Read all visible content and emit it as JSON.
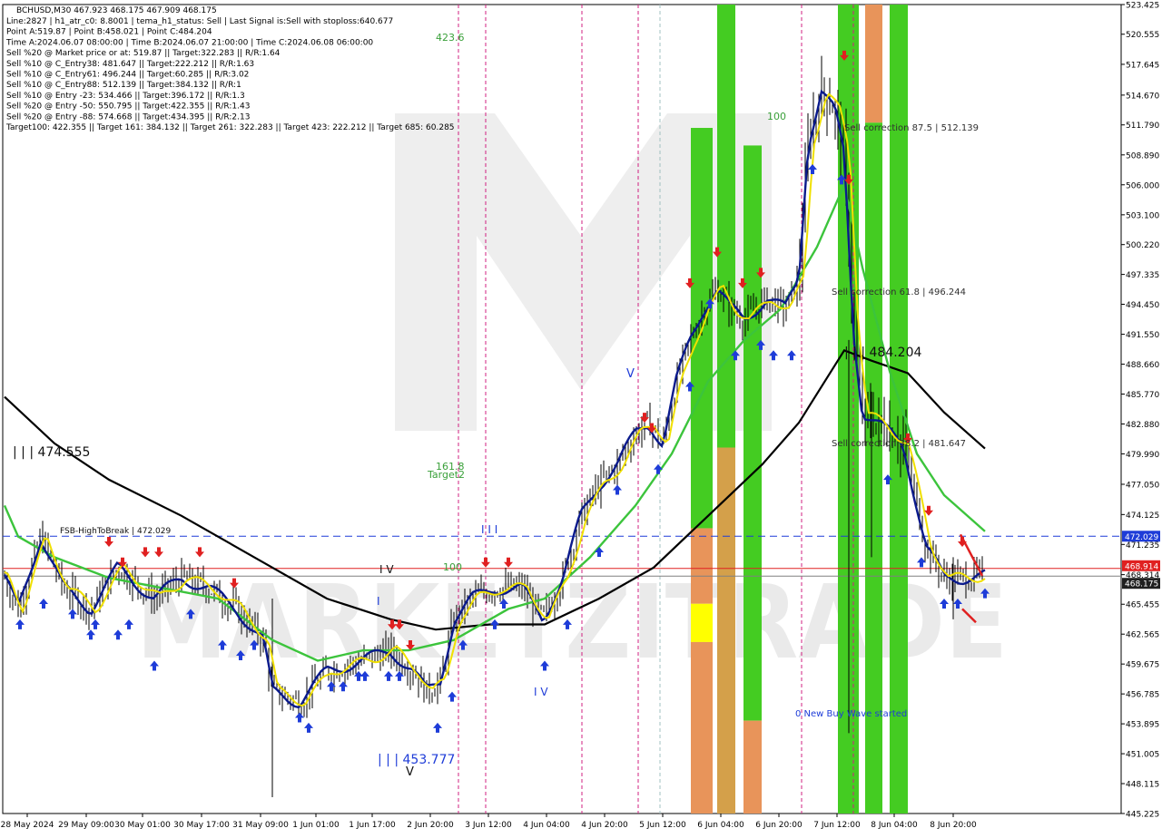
{
  "chart_data": {
    "type": "candlestick",
    "symbol_line": "BCHUSD,M30  467.923 468.175 467.909 468.175",
    "info_lines": [
      "Line:2827  |  h1_atr_c0: 8.8001  |  tema_h1_status: Sell  |  Last Signal is:Sell with stoploss:640.677",
      "Point A:519.87  |  Point B:458.021  |  Point C:484.204",
      "Time A:2024.06.07 08:00:00  |  Time B:2024.06.07 21:00:00  |  Time C:2024.06.08 06:00:00",
      "Sell %20 @ Market price or at: 519.87  ||  Target:322.283  ||  R/R:1.64",
      "Sell %10 @ C_Entry38: 481.647  ||  Target:222.212  ||  R/R:1.63",
      "Sell %10 @ C_Entry61: 496.244  ||  Target:60.285  ||  R/R:3.02",
      "Sell %10 @ C_Entry88: 512.139  ||  Target:384.132  ||  R/R:1",
      "Sell %10 @ Entry -23: 534.466  ||  Target:396.172  ||  R/R:1.3",
      "Sell %20 @ Entry -50: 550.795  ||  Target:422.355  ||  R/R:1.43",
      "Sell %20 @ Entry -88: 574.668  ||  Target:434.395  ||  R/R:2.13",
      "Target100: 422.355  ||  Target 161: 384.132  ||  Target 261: 322.283  ||  Target 423: 222.212  ||  Target 685: 60.285"
    ],
    "y_ticks": [
      523.425,
      520.555,
      517.645,
      514.67,
      511.79,
      508.89,
      506.0,
      503.1,
      500.22,
      497.335,
      494.45,
      491.55,
      488.66,
      485.77,
      482.88,
      479.99,
      477.05,
      474.125,
      471.235,
      468.314,
      465.455,
      462.565,
      459.675,
      456.785,
      453.895,
      451.005,
      448.115,
      445.225
    ],
    "ylim": [
      445.225,
      523.425
    ],
    "x_ticks": [
      "28 May 2024",
      "29 May 09:00",
      "30 May 01:00",
      "30 May 17:00",
      "31 May 09:00",
      "1 Jun 01:00",
      "1 Jun 17:00",
      "2 Jun 20:00",
      "3 Jun 12:00",
      "4 Jun 04:00",
      "4 Jun 20:00",
      "5 Jun 12:00",
      "6 Jun 04:00",
      "6 Jun 20:00",
      "7 Jun 12:00",
      "8 Jun 04:00",
      "8 Jun 20:00"
    ],
    "price_labels": [
      {
        "value": 472.029,
        "text": "472.029",
        "color": "#1e3cd8"
      },
      {
        "value": 468.914,
        "text": "468.914",
        "color": "#e02020"
      },
      {
        "value": 468.175,
        "text": "468.175",
        "color": "#202020"
      }
    ],
    "hlines": [
      {
        "value": 472.029,
        "color": "#1e3cd8",
        "style": "dashed"
      },
      {
        "value": 468.914,
        "color": "#e02020",
        "style": "solid"
      },
      {
        "value": 468.175,
        "color": "#808080",
        "style": "solid"
      }
    ],
    "annotations": [
      {
        "text": "423.6",
        "color": "#3aa03a"
      },
      {
        "text": "| | | 474.555",
        "color": "#101010"
      },
      {
        "text": "FSB-HighToBreak | 472.029",
        "color": "#101010"
      },
      {
        "text": "161.8",
        "color": "#3aa03a"
      },
      {
        "text": "Target2",
        "color": "#3aa03a"
      },
      {
        "text": "100",
        "color": "#3aa03a"
      },
      {
        "text": "100",
        "color": "#3aa03a"
      },
      {
        "text": "I V",
        "color": "#101010"
      },
      {
        "text": "I",
        "color": "#1e3cd8"
      },
      {
        "text": "I V",
        "color": "#1e3cd8"
      },
      {
        "text": "V",
        "color": "#1e3cd8"
      },
      {
        "text": "V",
        "color": "#101010"
      },
      {
        "text": "| | | 453.777",
        "color": "#1e3cd8"
      },
      {
        "text": "I I I",
        "color": "#1e3cd8"
      },
      {
        "text": "Sell correction 87.5 | 512.139",
        "color": "#303030"
      },
      {
        "text": "Sell correction 61.8 | 496.244",
        "color": "#303030"
      },
      {
        "text": "Sell correction 38.2 | 481.647",
        "color": "#303030"
      },
      {
        "text": "| | | 484.204",
        "color": "#101010"
      },
      {
        "text": "0 New Buy Wave started",
        "color": "#1e3cd8"
      }
    ],
    "watermark": "MARKETZITRADE",
    "colors": {
      "yellow": "#f0e000",
      "navy": "#0a1a8c",
      "green_ma": "#3cc43c",
      "black_ma": "#000000",
      "bar_green": "#44cc22",
      "bar_orange": "#e8945a",
      "up_arrow": "#1e3cd8",
      "down_arrow": "#e02020"
    }
  }
}
